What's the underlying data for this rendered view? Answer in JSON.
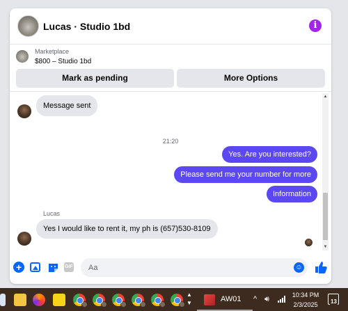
{
  "header": {
    "title": "Lucas · Studio 1bd",
    "info_icon_glyph": "i"
  },
  "listing": {
    "label": "Marketplace",
    "price_title": "$800 – Studio 1bd"
  },
  "actions": {
    "mark_pending": "Mark as pending",
    "more_options": "More Options"
  },
  "messages": {
    "incoming_1": "Message sent",
    "timestamp": "21:20",
    "outgoing": [
      "Yes. Are you interested?",
      "Please send me your number for more",
      "Information"
    ],
    "sender_name": "Lucas",
    "incoming_2": "Yes I would like to rent it, my ph is (657)530-8109"
  },
  "composer": {
    "placeholder": "Aa",
    "gif_label": "GIF"
  },
  "taskbar": {
    "app_label": "AW01",
    "time": "10:34 PM",
    "date": "2/3/2025",
    "notification_count": "13"
  },
  "colors": {
    "accent_blue": "#0866ff",
    "outgoing_bubble": "#5b48f0",
    "info_purple": "#a326e8",
    "taskbar_bg": "#3d2b1f"
  },
  "icons": {
    "composer": [
      "plus-icon",
      "image-icon",
      "sticker-icon",
      "gif-icon",
      "emoji-icon",
      "like-icon"
    ],
    "tray": [
      "chevron-up-icon",
      "volume-icon",
      "wifi-icon",
      "pen-icon",
      "notification-icon"
    ]
  }
}
